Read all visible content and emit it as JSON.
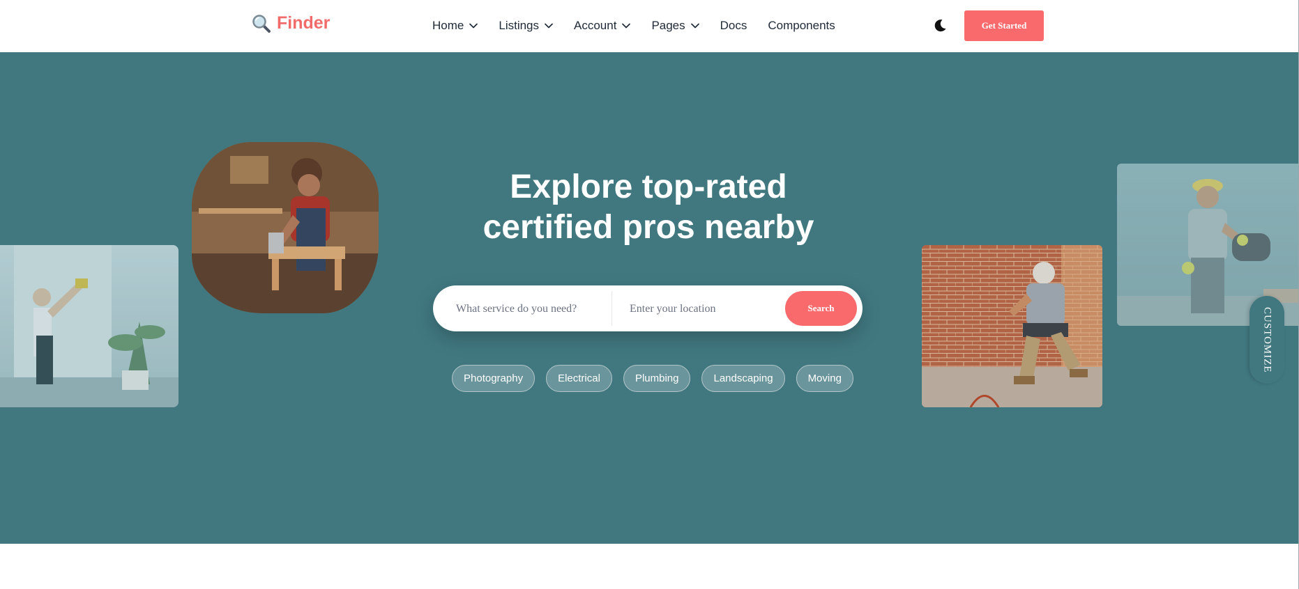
{
  "brand": {
    "name": "Finder",
    "icon": "magnifier-icon",
    "color": "#f26b6b"
  },
  "nav": {
    "items": [
      {
        "label": "Home",
        "has_dropdown": true
      },
      {
        "label": "Listings",
        "has_dropdown": true
      },
      {
        "label": "Account",
        "has_dropdown": true
      },
      {
        "label": "Pages",
        "has_dropdown": true
      },
      {
        "label": "Docs",
        "has_dropdown": false
      },
      {
        "label": "Components",
        "has_dropdown": false
      }
    ],
    "theme_toggle_icon": "moon-icon",
    "cta_label": "Get Started"
  },
  "hero": {
    "title": "Explore top-rated\ncertified pros nearby",
    "background_color": "#417880",
    "search": {
      "service_placeholder": "What service do you need?",
      "location_placeholder": "Enter your location",
      "button_label": "Search"
    },
    "categories": [
      "Photography",
      "Electrical",
      "Plumbing",
      "Landscaping",
      "Moving"
    ],
    "images": [
      "woodworker-photo",
      "cleaner-photo",
      "bricklayer-photo",
      "construction-worker-photo"
    ]
  },
  "customize_label": "CUSTOMIZE",
  "colors": {
    "accent": "#f96a6d",
    "text_dark": "#1f2937",
    "white": "#ffffff"
  }
}
